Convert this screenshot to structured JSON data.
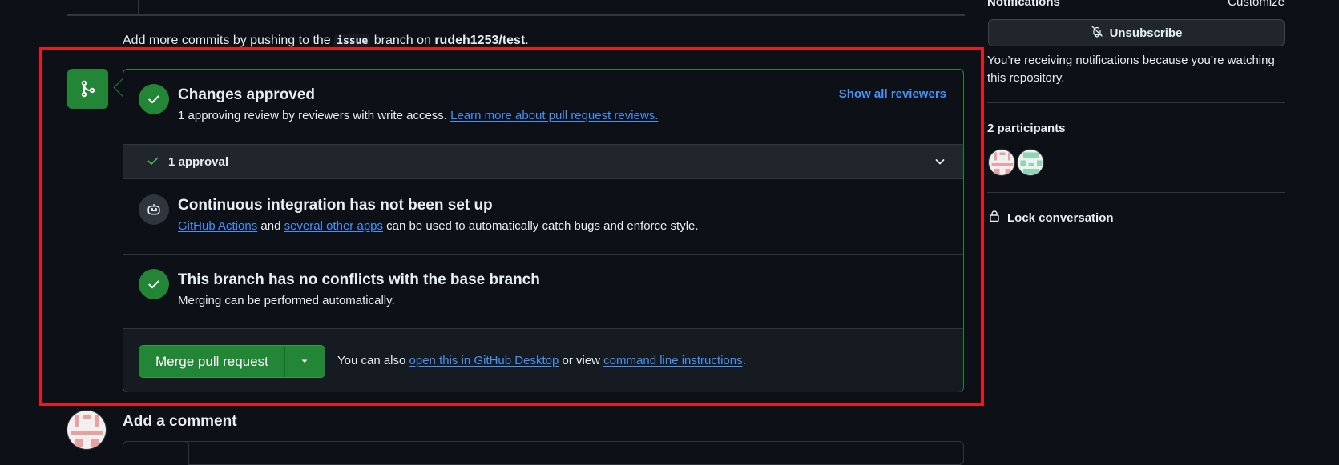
{
  "timeline": {
    "commits_note_prefix": "Add more commits by pushing to the ",
    "branch": "issue",
    "commits_note_middle": " branch on ",
    "repo": "rudeh1253/test",
    "commits_note_suffix": "."
  },
  "merge_box": {
    "approved": {
      "title": "Changes approved",
      "desc_prefix": "1 approving review by reviewers with write access. ",
      "desc_link": "Learn more about pull request reviews.",
      "show_all_reviewers": "Show all reviewers"
    },
    "approval_row": {
      "label": "1 approval"
    },
    "ci": {
      "title": "Continuous integration has not been set up",
      "link1": "GitHub Actions",
      "and": " and ",
      "link2": "several other apps",
      "desc_suffix": " can be used to automatically catch bugs and enforce style."
    },
    "conflicts": {
      "title": "This branch has no conflicts with the base branch",
      "desc": "Merging can be performed automatically."
    },
    "merge": {
      "button_label": "Merge pull request",
      "alt_prefix": "You can also ",
      "alt_link1": "open this in GitHub Desktop",
      "alt_middle": " or view ",
      "alt_link2": "command line instructions",
      "alt_suffix": "."
    }
  },
  "sidebar": {
    "notifications_heading": "Notifications",
    "customize": "Customize",
    "unsubscribe": "Unsubscribe",
    "notif_reason": "You’re receiving notifications because you’re watching this repository.",
    "participants_label": "2 participants",
    "lock_conversation": "Lock conversation"
  },
  "comment": {
    "title": "Add a comment"
  },
  "colors": {
    "background": "#0d1117",
    "success": "#238636",
    "link": "#4493f8",
    "highlight_border": "#e11d2a"
  },
  "icons": {
    "merge": "git-merge-icon",
    "check": "check-icon",
    "ci": "ci-robot-icon",
    "chevron": "chevron-down-icon",
    "bell_slash": "bell-slash-icon",
    "lock": "lock-icon",
    "triangle_down": "triangle-down-icon"
  }
}
